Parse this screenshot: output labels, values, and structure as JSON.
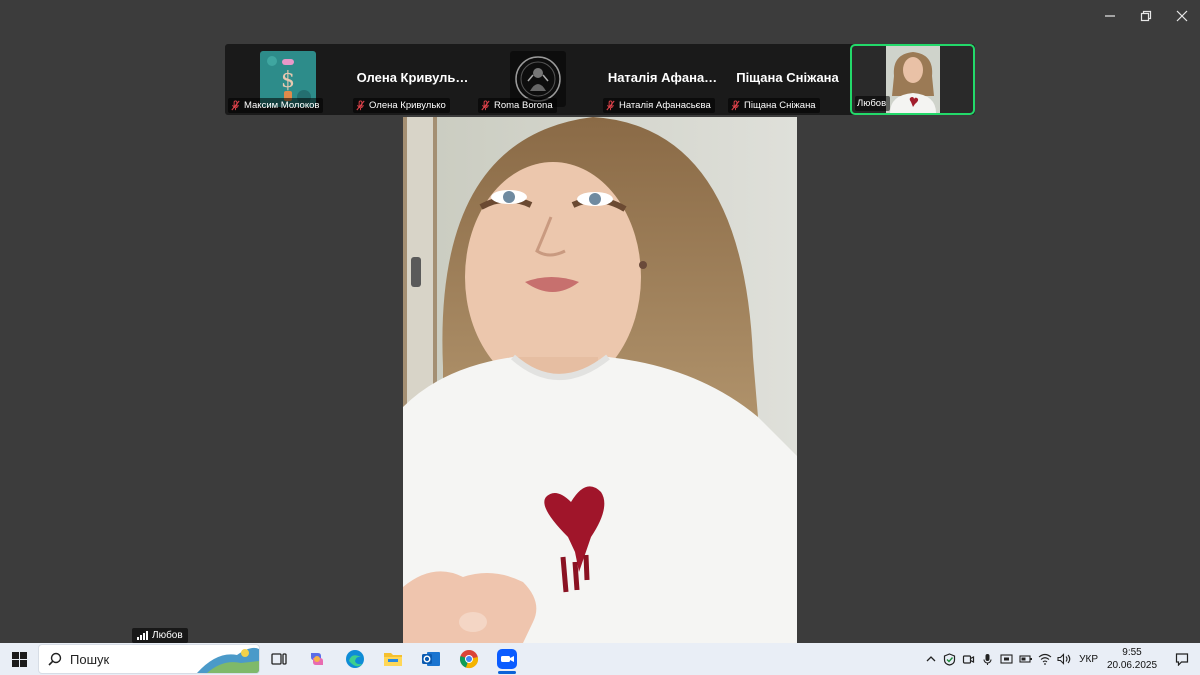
{
  "window_controls": {
    "minimize": "minimize",
    "restore": "restore",
    "close": "close"
  },
  "participants": [
    {
      "tile_label": "Максим Молоков",
      "display": "avatar",
      "mic": "muted"
    },
    {
      "tile_label": "Олена Кривулько",
      "display_name": "Олена  Кривуль…",
      "display": "name",
      "mic": "muted"
    },
    {
      "tile_label": "Roma Borona",
      "display": "avatar",
      "mic": "muted"
    },
    {
      "tile_label": "Наталія Афанасьєва",
      "display_name": "Наталія  Афана…",
      "display": "name",
      "mic": "muted"
    },
    {
      "tile_label": "Піщана Сніжана",
      "display_name": "Піщана Сніжана",
      "display": "name",
      "mic": "muted"
    },
    {
      "tile_label": "Любов",
      "display": "video",
      "active_speaker": true
    }
  ],
  "main_video": {
    "participant_name": "Любов"
  },
  "taskbar": {
    "search_placeholder": "Пошук",
    "apps": [
      "task-view",
      "copilot",
      "edge",
      "file-explorer",
      "outlook",
      "chrome",
      "zoom"
    ],
    "active_app": "zoom",
    "language": "УКР",
    "time": "9:55",
    "date": "20.06.2025"
  },
  "colors": {
    "active_border": "#23d96a",
    "background": "#3c3c3c",
    "taskbar": "#e9eef6"
  }
}
